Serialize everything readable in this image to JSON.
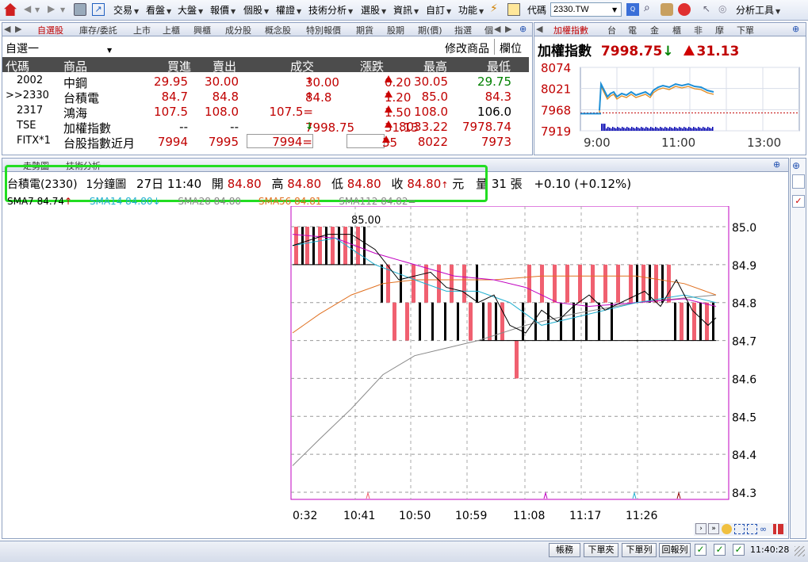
{
  "toolbar": {
    "menus": [
      "交易",
      "看盤",
      "大盤",
      "報價",
      "個股",
      "權證",
      "技術分析",
      "選股",
      "資訊",
      "自訂",
      "功能"
    ],
    "code_label": "代碼",
    "code_value": "2330.TW",
    "analysis_tools": "分析工具"
  },
  "watchlist": {
    "tabs": [
      "自選股",
      "庫存/委託",
      "上市",
      "上櫃",
      "興櫃",
      "成分股",
      "概念股",
      "特別報價",
      "期貨",
      "股期",
      "期(價)",
      "指選",
      "個"
    ],
    "group_name": "自選一",
    "edit_label": "修改商品",
    "column_label": "欄位",
    "columns": [
      "代碼",
      "商品",
      "買進",
      "賣出",
      "成交",
      "漲跌",
      "最高",
      "最低"
    ],
    "rows": [
      {
        "code": "2002",
        "name": "中鋼",
        "bid": "29.95",
        "ask": "30.00",
        "last": "30.00",
        "chg": "0.20",
        "high": "30.05",
        "low": "29.75"
      },
      {
        "code": ">>2330",
        "name": "台積電",
        "bid": "84.7",
        "ask": "84.8",
        "last": "84.8",
        "chg": "1.20",
        "high": "85.0",
        "low": "84.3"
      },
      {
        "code": "2317",
        "name": "鴻海",
        "bid": "107.5",
        "ask": "108.0",
        "last": "107.5=",
        "chg": "1.50",
        "high": "108.0",
        "low": "106.0"
      },
      {
        "code": "TSE",
        "name": "加權指數",
        "bid": "--",
        "ask": "--",
        "last": "7998.75",
        "chg": "31.13",
        "high": "8033.22",
        "low": "7978.74"
      },
      {
        "code": "FITX*1",
        "name": "台股指數近月",
        "bid": "7994",
        "ask": "7995",
        "last": "7994=",
        "chg": "35",
        "high": "8022",
        "low": "7973"
      }
    ]
  },
  "index_panel": {
    "tabs": [
      "加權指數",
      "台",
      "電",
      "金",
      "櫃",
      "非",
      "摩",
      "下單"
    ],
    "title": "加權指數",
    "value": "7998.75",
    "change": "31.13",
    "y_labels": [
      "8074",
      "8021",
      "7968",
      "7919"
    ],
    "x_labels": [
      "9:00",
      "11:00",
      "13:00"
    ],
    "colors": {
      "price": "#1e8fd6",
      "avg": "#e08a20",
      "volume": "#0000b0",
      "ref": "#c00000"
    }
  },
  "chart_panel": {
    "tabs": [
      "走勢圖",
      "技術分析"
    ],
    "info": {
      "symbol": "台積電(2330)",
      "period": "1分鐘圖",
      "datetime": "27日 11:40",
      "open_label": "開",
      "open": "84.80",
      "high_label": "高",
      "high": "84.80",
      "low_label": "低",
      "low": "84.80",
      "close_label": "收",
      "close": "84.80",
      "unit": "元",
      "volume": "量 31 張",
      "change": "+0.10 (+0.12%)"
    },
    "ma_labels": {
      "ma7": "SMA7 84.74",
      "ma14": "SMA14 84.80",
      "ma28": "SMA28 84.80",
      "ma56": "SMA56 84.81",
      "ma112": "SMA112 84.82="
    },
    "peak_label": "85.00",
    "y_labels": [
      "85.0",
      "84.9",
      "84.8",
      "84.7",
      "84.6",
      "84.5",
      "84.4",
      "84.3"
    ],
    "x_labels": [
      ":0:32",
      "10:41",
      "10:50",
      "10:59",
      "11:08",
      "11:17",
      "11:26"
    ],
    "colors": {
      "up": "#f06070",
      "down": "#000000",
      "sma7": "#000000",
      "sma14": "#20b0d0",
      "sma28": "#c000c0",
      "sma56": "#e07020",
      "sma112": "#888888"
    }
  },
  "status_bar": {
    "buttons": [
      "帳務",
      "下單夾",
      "下單列",
      "回報列"
    ],
    "time": "11:40:28"
  }
}
